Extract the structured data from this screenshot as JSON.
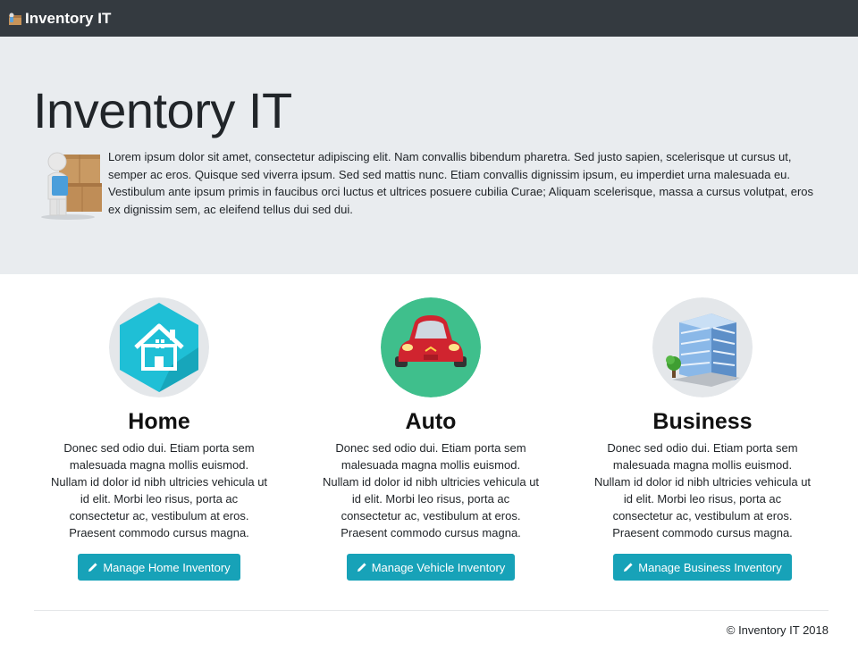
{
  "nav": {
    "brand": "Inventory IT"
  },
  "jumbotron": {
    "title": "Inventory IT",
    "text": "Lorem ipsum dolor sit amet, consectetur adipiscing elit. Nam convallis bibendum pharetra. Sed justo sapien, scelerisque ut cursus ut, semper ac eros. Quisque sed viverra ipsum. Sed sed mattis nunc. Etiam convallis dignissim ipsum, eu imperdiet urna malesuada eu. Vestibulum ante ipsum primis in faucibus orci luctus et ultrices posuere cubilia Curae; Aliquam scelerisque, massa a cursus volutpat, eros ex dignissim sem, ac eleifend tellus dui sed dui."
  },
  "columns": [
    {
      "title": "Home",
      "icon": "house-icon",
      "text": "Donec sed odio dui. Etiam porta sem malesuada magna mollis euismod. Nullam id dolor id nibh ultricies vehicula ut id elit. Morbi leo risus, porta ac consectetur ac, vestibulum at eros. Praesent commodo cursus magna.",
      "button": "Manage Home Inventory"
    },
    {
      "title": "Auto",
      "icon": "car-icon",
      "text": "Donec sed odio dui. Etiam porta sem malesuada magna mollis euismod. Nullam id dolor id nibh ultricies vehicula ut id elit. Morbi leo risus, porta ac consectetur ac, vestibulum at eros. Praesent commodo cursus magna.",
      "button": "Manage Vehicle Inventory"
    },
    {
      "title": "Business",
      "icon": "building-icon",
      "text": "Donec sed odio dui. Etiam porta sem malesuada magna mollis euismod. Nullam id dolor id nibh ultricies vehicula ut id elit. Morbi leo risus, porta ac consectetur ac, vestibulum at eros. Praesent commodo cursus magna.",
      "button": "Manage Business Inventory"
    }
  ],
  "footer": {
    "copyright": "© Inventory IT 2018"
  },
  "colors": {
    "navbar": "#343a40",
    "jumbotron": "#e9ecef",
    "button": "#17a2b8"
  }
}
